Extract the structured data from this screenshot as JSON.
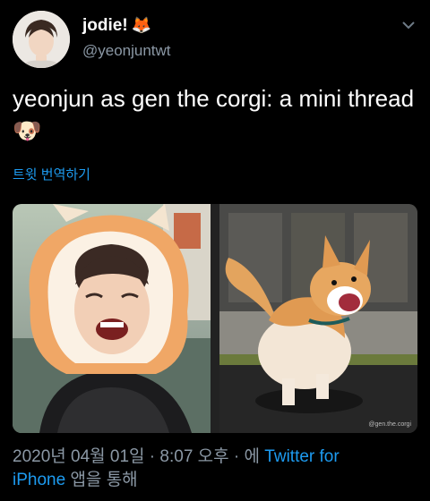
{
  "author": {
    "display_name": "jodie!",
    "emoji": "🦊",
    "handle": "@yeonjuntwt"
  },
  "tweet": {
    "text": "yeonjun as gen the corgi: a mini thread",
    "emoji": "🐶",
    "translate_label": "트윗 번역하기"
  },
  "photos": {
    "right_watermark": "@gen.the.corgi"
  },
  "meta": {
    "timestamp": "2020년 04월 01일 · 8:07 오후 ·",
    "via": "에",
    "source_line1": "Twitter for",
    "source_line2": "iPhone",
    "suffix": "앱을 통해"
  }
}
